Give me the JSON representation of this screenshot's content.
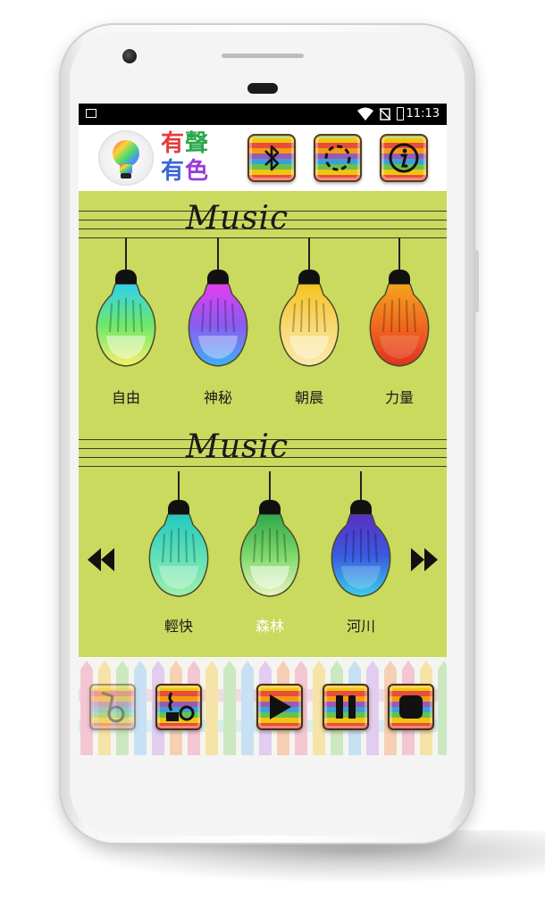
{
  "status_bar": {
    "time": "11:13"
  },
  "app": {
    "title_chars": [
      "有",
      "聲",
      "有",
      "色"
    ]
  },
  "header_buttons": [
    {
      "name": "bluetooth-button",
      "icon": "bluetooth-icon"
    },
    {
      "name": "timer-button",
      "icon": "dashed-circle-icon"
    },
    {
      "name": "info-button",
      "icon": "info-icon"
    }
  ],
  "sections": [
    {
      "title": "Music",
      "lamps": [
        {
          "label": "自由",
          "colors": [
            "#2fd0f0",
            "#6ee86a",
            "#f5f06a"
          ]
        },
        {
          "label": "神秘",
          "colors": [
            "#e23df0",
            "#8a5cf0",
            "#3fb0f5"
          ]
        },
        {
          "label": "朝晨",
          "colors": [
            "#f5c21f",
            "#f8d870",
            "#fbe9b0"
          ]
        },
        {
          "label": "力量",
          "colors": [
            "#f5a31f",
            "#f06a1f",
            "#e0301f"
          ]
        }
      ]
    },
    {
      "title": "Music",
      "lamps": [
        {
          "label": "輕快",
          "colors": [
            "#24c8c0",
            "#5de0b8",
            "#9df0a8"
          ]
        },
        {
          "label": "森林",
          "colors": [
            "#2fa84a",
            "#7ed86a",
            "#e8f5c0"
          ]
        },
        {
          "label": "河川",
          "colors": [
            "#5a2fc0",
            "#3a5ae0",
            "#3ad0e8"
          ]
        }
      ]
    }
  ],
  "selected_label": "森林",
  "controls": [
    {
      "name": "visualizer-button",
      "icon": "tone-arm-icon"
    },
    {
      "name": "record-player-button",
      "icon": "gramophone-icon"
    },
    {
      "name": "play-button",
      "icon": "play-icon"
    },
    {
      "name": "pause-button",
      "icon": "pause-icon"
    },
    {
      "name": "stop-button",
      "icon": "stop-icon"
    }
  ],
  "colors": {
    "background": "#c9da5f",
    "selected_label": "#ffffff"
  }
}
